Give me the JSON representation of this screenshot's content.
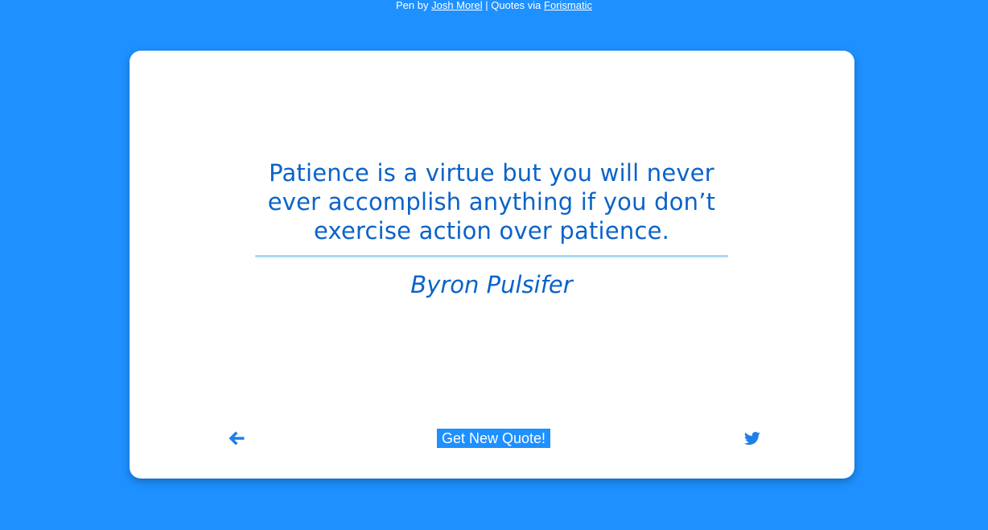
{
  "credits": {
    "prefix": "Pen by ",
    "author_link": "Josh Morel",
    "separator": " | Quotes via ",
    "source_link": "Forismatic"
  },
  "quote": {
    "text": "Patience is a virtue but you will never ever accomplish anything if you don’t exercise action over patience.",
    "author": "Byron Pulsifer"
  },
  "controls": {
    "back_icon": "arrow-left-icon",
    "new_quote_label": "Get New Quote!",
    "tweet_icon": "twitter-icon"
  },
  "colors": {
    "background": "#1e90ff",
    "quote_text": "#0a63c9",
    "divider": "#a9d8f7"
  }
}
